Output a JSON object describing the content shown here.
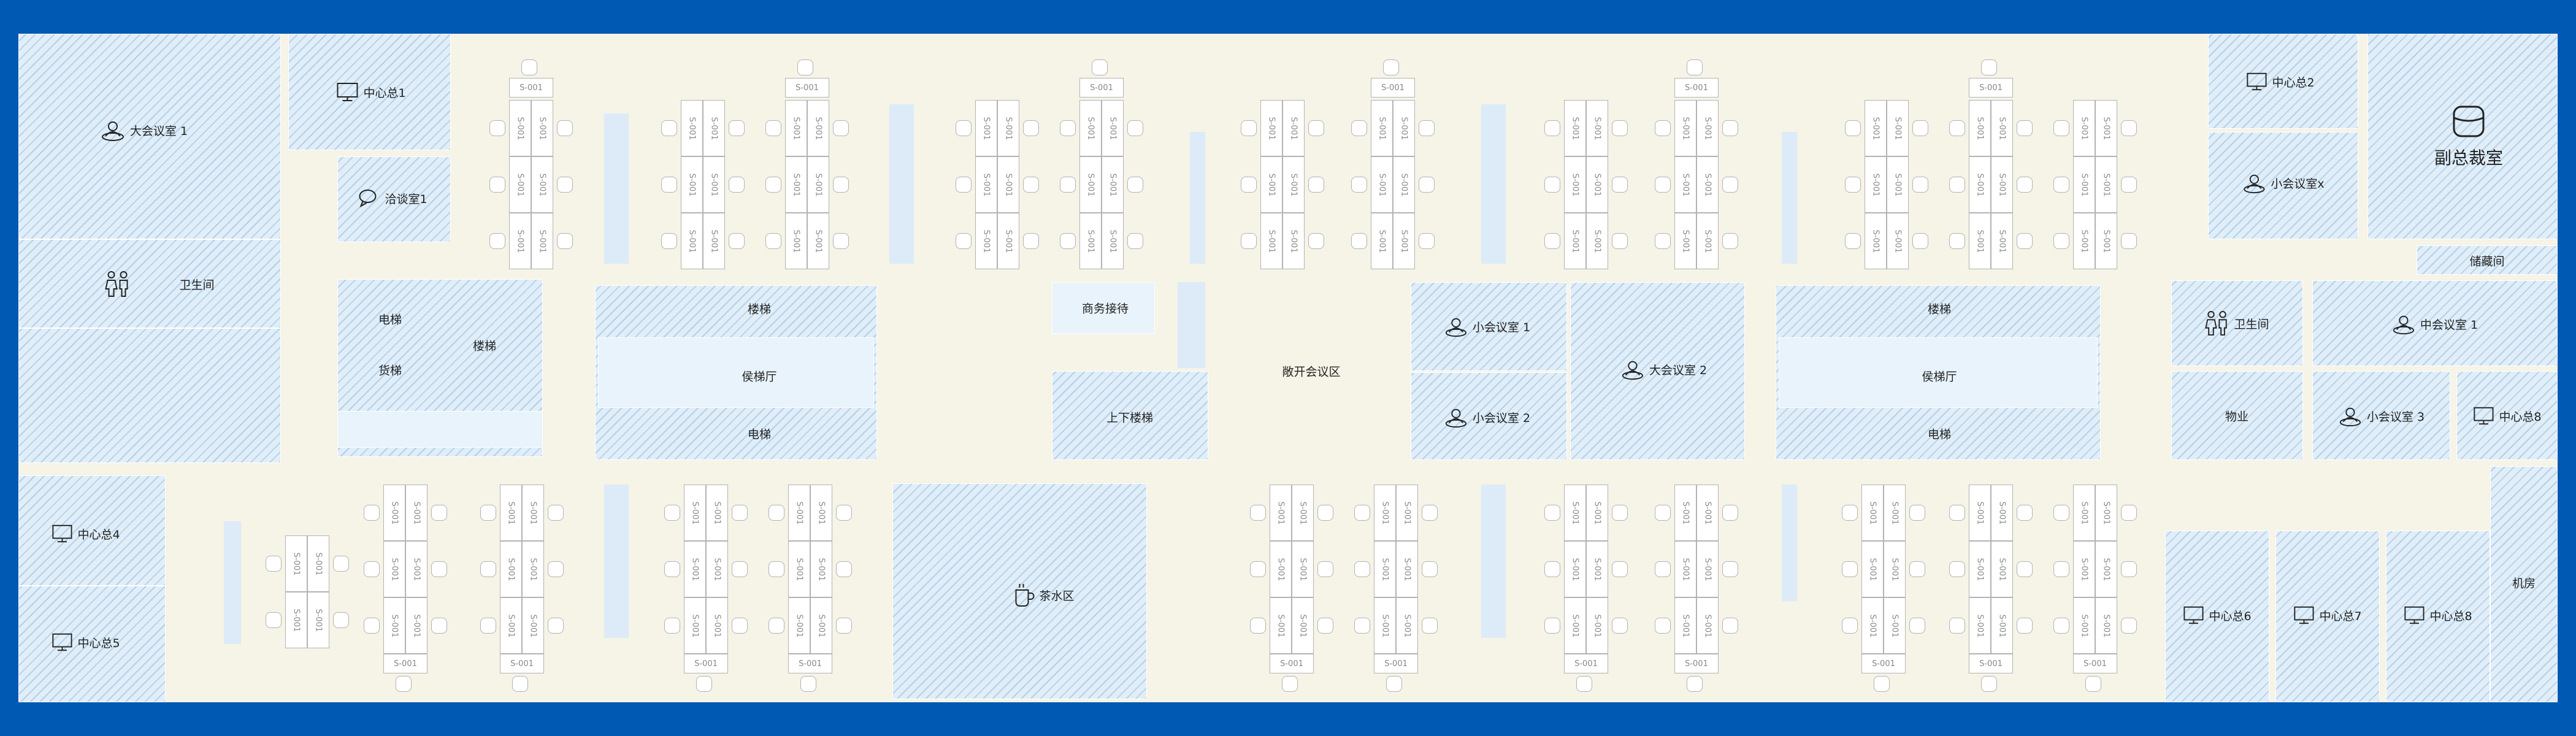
{
  "colors": {
    "frame": "#0059b3",
    "floor": "#f6f3e7",
    "room": "#e1eef8",
    "hatch": "#8cb9e1",
    "desk_border": "#b3b3b3"
  },
  "desk_label": "S-001",
  "rooms": {
    "big_meeting_1": "大会议室 1",
    "center_1": "中心总1",
    "negotiation_1": "洽谈室1",
    "restroom_left": "卫生间",
    "elevator": "电梯",
    "stairs": "楼梯",
    "freight_elevator": "货梯",
    "stairs_mid": "楼梯",
    "lobby_mid": "侯梯厅",
    "elevator_mid": "电梯",
    "business_reception": "商务接待",
    "updown_stairs": "上下楼梯",
    "open_meeting": "敞开会议区",
    "small_meeting_1": "小会议室 1",
    "small_meeting_2": "小会议室 2",
    "big_meeting_2": "大会议室 2",
    "stairs_right": "楼梯",
    "lobby_right": "侯梯厅",
    "elevator_right": "电梯",
    "center_2": "中心总2",
    "small_meeting_x": "小会议室x",
    "vp_office": "副总裁室",
    "storage": "储藏间",
    "restroom_right": "卫生间",
    "small_meeting_r1": "中会议室 1",
    "property": "物业",
    "small_meeting_3": "小会议室 3",
    "center_8_right": "中心总8",
    "center_4": "中心总4",
    "center_5": "中心总5",
    "tea_area": "茶水区",
    "server_room": "机房",
    "center_6": "中心总6",
    "center_7": "中心总7",
    "center_8_bottom": "中心总8"
  },
  "icons": {
    "meeting": "meeting-room-icon",
    "monitor": "monitor-icon",
    "chat": "chat-bubble-icon",
    "restroom": "restroom-icon",
    "cup": "coffee-cup-icon",
    "sofa": "sofa-icon"
  }
}
